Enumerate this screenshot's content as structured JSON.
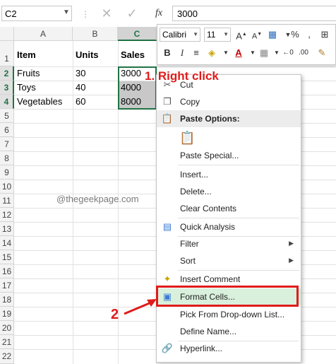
{
  "formula_bar": {
    "name_box": "C2",
    "formula_value": "3000"
  },
  "columns": [
    "A",
    "B",
    "C"
  ],
  "rows": [
    "1",
    "2",
    "3",
    "4",
    "5",
    "6",
    "7",
    "8",
    "9",
    "10",
    "11",
    "12",
    "13",
    "14",
    "15",
    "16",
    "17",
    "18",
    "19",
    "20",
    "21",
    "22"
  ],
  "table": {
    "headers": [
      "Item",
      "Units",
      "Sales"
    ],
    "data": [
      [
        "Fruits",
        "30",
        "3000"
      ],
      [
        "Toys",
        "40",
        "4000"
      ],
      [
        "Vegetables",
        "60",
        "8000"
      ]
    ]
  },
  "watermark": "@thegeekpage.com",
  "mini_toolbar": {
    "font_name": "Calibri",
    "font_size": "11"
  },
  "context_menu": {
    "items": [
      {
        "label": "Cut"
      },
      {
        "label": "Copy"
      },
      {
        "label": "Paste Options:"
      },
      {
        "label": "Paste Special..."
      },
      {
        "label": "Insert..."
      },
      {
        "label": "Delete..."
      },
      {
        "label": "Clear Contents"
      },
      {
        "label": "Quick Analysis"
      },
      {
        "label": "Filter"
      },
      {
        "label": "Sort"
      },
      {
        "label": "Insert Comment"
      },
      {
        "label": "Format Cells..."
      },
      {
        "label": "Pick From Drop-down List..."
      },
      {
        "label": "Define Name..."
      },
      {
        "label": "Hyperlink..."
      }
    ]
  },
  "annotations": {
    "step1": "1. Right click",
    "step2": "2"
  },
  "colors": {
    "excel_green": "#217346",
    "annotation_red": "#e01b1b",
    "highlight_green": "#d9f0dc"
  },
  "icons": [
    "fx-icon",
    "cancel-x-icon",
    "checkmark-icon",
    "scissors-icon",
    "copy-icon",
    "clipboard-icon",
    "quick-analysis-icon",
    "comment-icon",
    "format-cells-icon",
    "hyperlink-icon"
  ]
}
